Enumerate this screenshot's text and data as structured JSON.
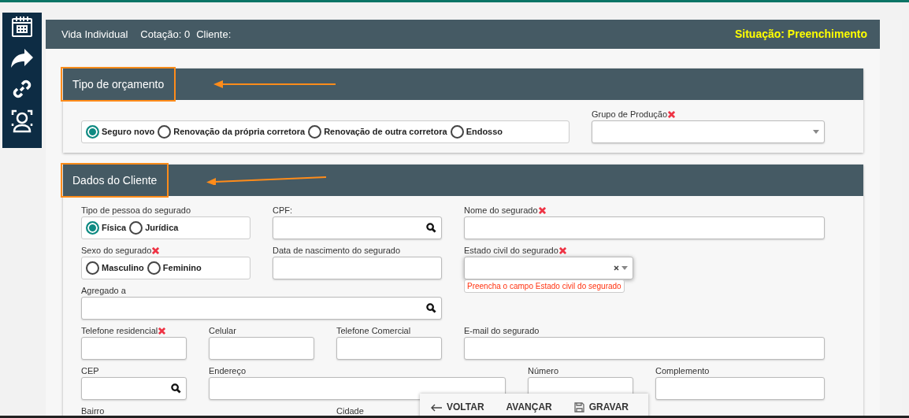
{
  "sidebar": {
    "items": [
      {
        "kind": "calendar"
      },
      {
        "kind": "share"
      },
      {
        "kind": "link"
      },
      {
        "kind": "person"
      }
    ]
  },
  "header": {
    "product": "Vida Individual",
    "quote": "Cotação: 0",
    "client": "Cliente:",
    "status": "Situação: Preenchimento"
  },
  "sections": [
    {
      "title": "Tipo de orçamento",
      "highlighted": true,
      "fields": [
        {
          "kind": "radio",
          "options": [
            {
              "label": "Seguro novo",
              "selected": true
            },
            {
              "label": "Renovação da própria corretora",
              "selected": false
            },
            {
              "label": "Renovação de outra corretora",
              "selected": false
            },
            {
              "label": "Endosso",
              "selected": false
            }
          ]
        },
        {
          "kind": "select",
          "label": "Grupo de Produção",
          "required": true
        }
      ]
    },
    {
      "title": "Dados do Cliente",
      "highlighted": true,
      "fields": [
        {
          "kind": "radio",
          "label": "Tipo de pessoa do segurado",
          "required": false,
          "options": [
            {
              "label": "Física",
              "selected": true
            },
            {
              "label": "Jurídica",
              "selected": false
            }
          ]
        },
        {
          "kind": "search",
          "label": "CPF:",
          "required": false
        },
        {
          "kind": "text",
          "label": "Nome do segurado",
          "required": true
        },
        {
          "kind": "radio",
          "label": "Sexo do segurado",
          "required": true,
          "options": [
            {
              "label": "Masculino",
              "selected": false
            },
            {
              "label": "Feminino",
              "selected": false
            }
          ]
        },
        {
          "kind": "text",
          "label": "Data de nascimento do segurado",
          "required": false
        },
        {
          "kind": "select",
          "label": "Estado civil do segurado",
          "required": true,
          "clearable": true,
          "focused": true,
          "error": "Preencha o campo Estado civil do segurado"
        },
        {
          "kind": "search",
          "label": "Agregado a",
          "required": false
        },
        {
          "kind": "text",
          "label": "Telefone residencial",
          "required": true
        },
        {
          "kind": "text",
          "label": "Celular",
          "required": false
        },
        {
          "kind": "text",
          "label": "Telefone Comercial",
          "required": false
        },
        {
          "kind": "text",
          "label": "E-mail do segurado",
          "required": false
        },
        {
          "kind": "search",
          "label": "CEP",
          "required": false
        },
        {
          "kind": "text",
          "label": "Endereço",
          "required": false
        },
        {
          "kind": "text",
          "label": "Número",
          "required": false
        },
        {
          "kind": "text",
          "label": "Complemento",
          "required": false
        },
        {
          "kind": "label",
          "label": "Bairro",
          "required": false
        },
        {
          "kind": "label",
          "label": "Cidade",
          "required": false
        }
      ]
    }
  ],
  "actions": [
    {
      "kind": "back",
      "label": "VOLTAR"
    },
    {
      "kind": "next",
      "label": "AVANÇAR"
    },
    {
      "kind": "save",
      "label": "GRAVAR"
    }
  ]
}
